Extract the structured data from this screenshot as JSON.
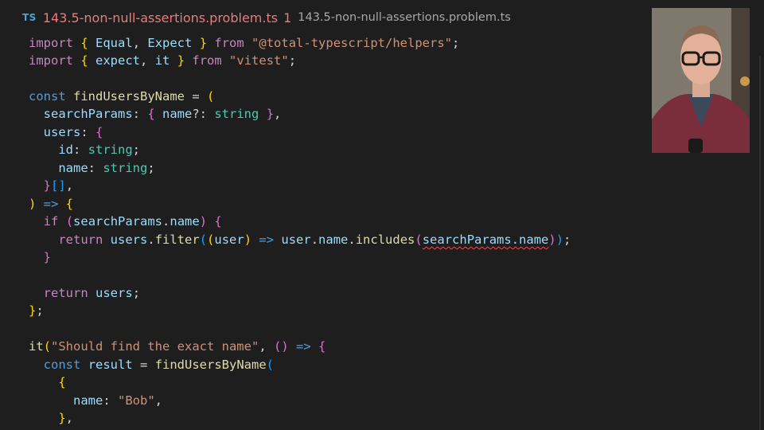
{
  "tab": {
    "language_badge": "TS",
    "filename": "143.5-non-null-assertions.problem.ts",
    "problem_count": "1",
    "path": "143.5-non-null-assertions.problem.ts"
  },
  "colors": {
    "background": "#1e1e1e",
    "error_tab": "#f07878",
    "ts_badge": "#4aa3e0",
    "keyword": "#c586c0",
    "storage": "#569cd6",
    "type": "#4ec9b0",
    "variable": "#9cdcfe",
    "function": "#dcdcaa",
    "string": "#ce9178",
    "squiggle_error": "#f14c4c"
  },
  "code": {
    "line1": {
      "t0": "import ",
      "t1": "{",
      "t2": " ",
      "t3": "Equal",
      "t4": ", ",
      "t5": "Expect",
      "t6": " ",
      "t7": "}",
      "t8": " from ",
      "t9": "\"@total-typescript/helpers\"",
      "t10": ";"
    },
    "line2": {
      "t0": "import ",
      "t1": "{",
      "t2": " ",
      "t3": "expect",
      "t4": ", ",
      "t5": "it",
      "t6": " ",
      "t7": "}",
      "t8": " from ",
      "t9": "\"vitest\"",
      "t10": ";"
    },
    "line4": {
      "t0": "const ",
      "t1": "findUsersByName",
      "t2": " = ",
      "t3": "("
    },
    "line5": {
      "t0": "  ",
      "t1": "searchParams",
      "t2": ": ",
      "t3": "{",
      "t4": " ",
      "t5": "name",
      "t6": "?: ",
      "t7": "string",
      "t8": " ",
      "t9": "}",
      "t10": ","
    },
    "line6": {
      "t0": "  ",
      "t1": "users",
      "t2": ": ",
      "t3": "{"
    },
    "line7": {
      "t0": "    ",
      "t1": "id",
      "t2": ": ",
      "t3": "string",
      "t4": ";"
    },
    "line8": {
      "t0": "    ",
      "t1": "name",
      "t2": ": ",
      "t3": "string",
      "t4": ";"
    },
    "line9": {
      "t0": "  ",
      "t1": "}",
      "t2": "[]",
      "t3": ","
    },
    "line10": {
      "t0": ")",
      "t1": " => ",
      "t2": "{"
    },
    "line11": {
      "t0": "  ",
      "t1": "if",
      "t2": " ",
      "t3": "(",
      "t4": "searchParams",
      "t5": ".",
      "t6": "name",
      "t7": ")",
      "t8": " ",
      "t9": "{"
    },
    "line12": {
      "t0": "    ",
      "t1": "return",
      "t2": " ",
      "t3": "users",
      "t4": ".",
      "t5": "filter",
      "t6": "(",
      "t7": "(",
      "t8": "user",
      "t9": ")",
      "t10": " => ",
      "t11": "user",
      "t12": ".",
      "t13": "name",
      "t14": ".",
      "t15": "includes",
      "t16": "(",
      "t17": "searchParams.name",
      "t18": ")",
      "t19": ")",
      "t20": ";"
    },
    "line13": {
      "t0": "  ",
      "t1": "}"
    },
    "line15": {
      "t0": "  ",
      "t1": "return",
      "t2": " ",
      "t3": "users",
      "t4": ";"
    },
    "line16": {
      "t0": "}",
      "t1": ";"
    },
    "line18": {
      "t0": "it",
      "t1": "(",
      "t2": "\"Should find the exact name\"",
      "t3": ", ",
      "t4": "(",
      "t5": ")",
      "t6": " => ",
      "t7": "{"
    },
    "line19": {
      "t0": "  ",
      "t1": "const",
      "t2": " ",
      "t3": "result",
      "t4": " = ",
      "t5": "findUsersByName",
      "t6": "("
    },
    "line20": {
      "t0": "    ",
      "t1": "{"
    },
    "line21": {
      "t0": "      ",
      "t1": "name",
      "t2": ": ",
      "t3": "\"Bob\"",
      "t4": ","
    },
    "line22": {
      "t0": "    ",
      "t1": "}",
      "t2": ","
    }
  }
}
